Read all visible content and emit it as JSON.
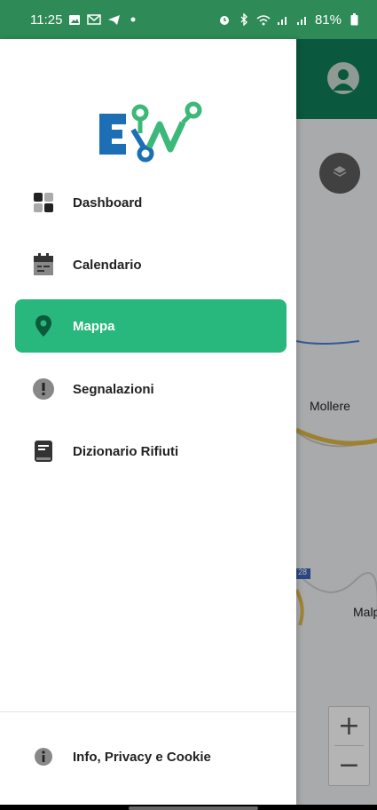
{
  "status_bar": {
    "time": "11:25",
    "battery": "81%",
    "left_icons": [
      "image-icon",
      "gmail-icon",
      "telegram-icon",
      "dot-icon"
    ],
    "right_icons": [
      "alarm-icon",
      "bluetooth-icon",
      "wifi-icon",
      "signal-icon",
      "signal-icon",
      "battery-icon"
    ]
  },
  "map": {
    "places": [
      "Mollere",
      "Malp"
    ],
    "road_label": "28",
    "zoom_in": "+",
    "zoom_out": "−"
  },
  "drawer": {
    "logo": "EW",
    "items": [
      {
        "label": "Dashboard",
        "icon": "dashboard-icon",
        "active": false
      },
      {
        "label": "Calendario",
        "icon": "calendar-icon",
        "active": false
      },
      {
        "label": "Mappa",
        "icon": "map-pin-icon",
        "active": true
      },
      {
        "label": "Segnalazioni",
        "icon": "alert-icon",
        "active": false
      },
      {
        "label": "Dizionario Rifiuti",
        "icon": "book-icon",
        "active": false
      }
    ],
    "footer": {
      "label": "Info, Privacy e Cookie",
      "icon": "info-icon"
    }
  },
  "colors": {
    "header_green": "#0f7a55",
    "status_green": "#2e8b57",
    "active_green": "#28b77c",
    "logo_blue": "#1c6fb5",
    "logo_green": "#3cb878"
  }
}
